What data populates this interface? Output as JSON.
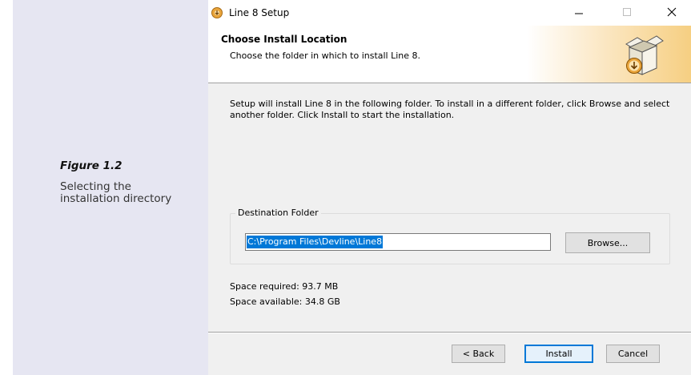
{
  "caption": {
    "figure_label": "Figure 1.2",
    "description": "Selecting the installation directory"
  },
  "window": {
    "title": "Line 8 Setup",
    "app_icon": "installer-disc-icon",
    "controls": [
      "minimize-icon",
      "maximize-icon",
      "close-icon"
    ]
  },
  "header": {
    "title": "Choose Install Location",
    "subtitle": "Choose the folder in which to install Line 8.",
    "icon": "install-box-icon"
  },
  "body": {
    "intro": "Setup will install Line 8 in the following folder. To install in a different folder, click Browse and select another folder. Click Install to start the installation.",
    "destination": {
      "group_label": "Destination Folder",
      "path": "C:\\Program Files\\Devline\\Line8",
      "browse_label": "Browse..."
    },
    "space_required": "Space required: 93.7 MB",
    "space_available": "Space available: 34.8 GB"
  },
  "footer": {
    "back_label": "< Back",
    "install_label": "Install",
    "cancel_label": "Cancel"
  },
  "colors": {
    "caption_bg": "#e6e6f2",
    "selection": "#0078d7",
    "dialog_bg": "#f0f0f0"
  }
}
